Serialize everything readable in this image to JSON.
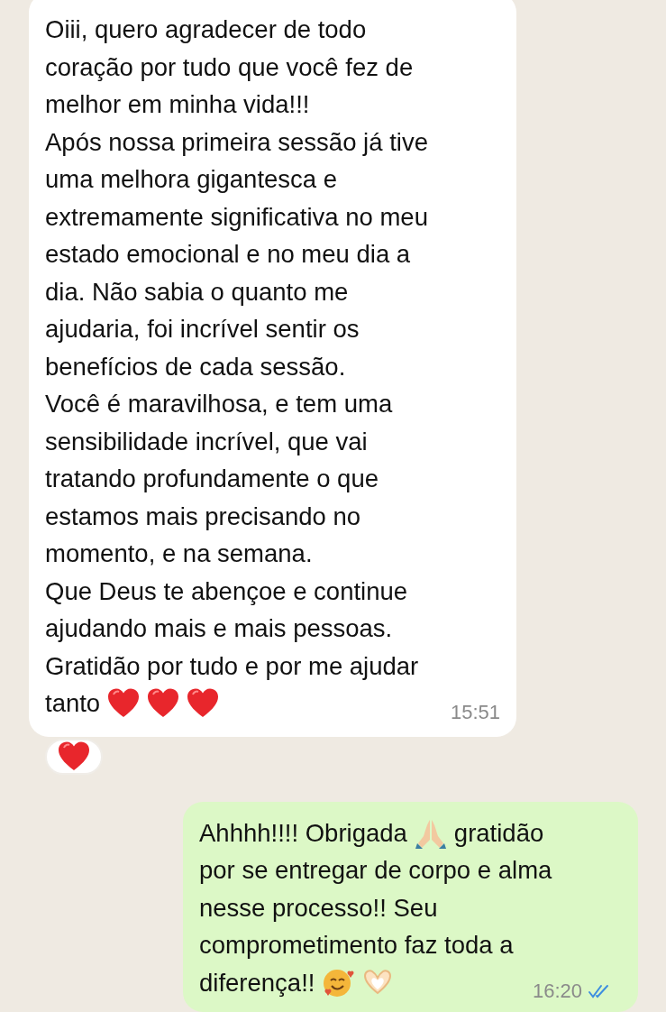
{
  "messages": [
    {
      "kind": "incoming",
      "lines": [
        [
          {
            "kind": "text",
            "text": "Oiii, quero agradecer de todo"
          }
        ],
        [
          {
            "kind": "text",
            "text": "coração por tudo que você fez de"
          }
        ],
        [
          {
            "kind": "text",
            "text": "melhor em minha vida!!!"
          }
        ],
        [
          {
            "kind": "text",
            "text": "Após nossa primeira sessão já tive"
          }
        ],
        [
          {
            "kind": "text",
            "text": "uma melhora gigantesca e"
          }
        ],
        [
          {
            "kind": "text",
            "text": "extremamente significativa no meu"
          }
        ],
        [
          {
            "kind": "text",
            "text": "estado emocional e no meu dia a"
          }
        ],
        [
          {
            "kind": "text",
            "text": "dia. Não sabia o quanto me"
          }
        ],
        [
          {
            "kind": "text",
            "text": "ajudaria, foi incrível sentir os"
          }
        ],
        [
          {
            "kind": "text",
            "text": "benefícios de cada sessão."
          }
        ],
        [
          {
            "kind": "text",
            "text": "Você é maravilhosa, e tem uma"
          }
        ],
        [
          {
            "kind": "text",
            "text": "sensibilidade incrível, que vai"
          }
        ],
        [
          {
            "kind": "text",
            "text": "tratando profundamente o que"
          }
        ],
        [
          {
            "kind": "text",
            "text": "estamos mais precisando no"
          }
        ],
        [
          {
            "kind": "text",
            "text": "momento, e na semana."
          }
        ],
        [
          {
            "kind": "text",
            "text": "Que Deus te abençoe e continue"
          }
        ],
        [
          {
            "kind": "text",
            "text": "ajudando mais e mais pessoas."
          }
        ],
        [
          {
            "kind": "text",
            "text": "Gratidão por tudo e por me ajudar"
          }
        ],
        [
          {
            "kind": "text",
            "text": "tanto"
          },
          {
            "kind": "heart"
          },
          {
            "kind": "heart"
          },
          {
            "kind": "heart"
          }
        ]
      ],
      "time": "15:51",
      "reaction": {
        "kind": "heart"
      }
    },
    {
      "kind": "outgoing",
      "lines": [
        [
          {
            "kind": "text",
            "text": "Ahhhh!!!! Obrigada"
          },
          {
            "kind": "pray"
          },
          {
            "kind": "text",
            "text": "gratidão"
          }
        ],
        [
          {
            "kind": "text",
            "text": "por se entregar de corpo e alma"
          }
        ],
        [
          {
            "kind": "text",
            "text": "nesse processo!! Seu"
          }
        ],
        [
          {
            "kind": "text",
            "text": "comprometimento faz toda a"
          }
        ],
        [
          {
            "kind": "text",
            "text": "diferença!!"
          },
          {
            "kind": "smile-hearts"
          },
          {
            "kind": "heart-hands"
          }
        ]
      ],
      "time": "16:20",
      "read": true
    }
  ]
}
